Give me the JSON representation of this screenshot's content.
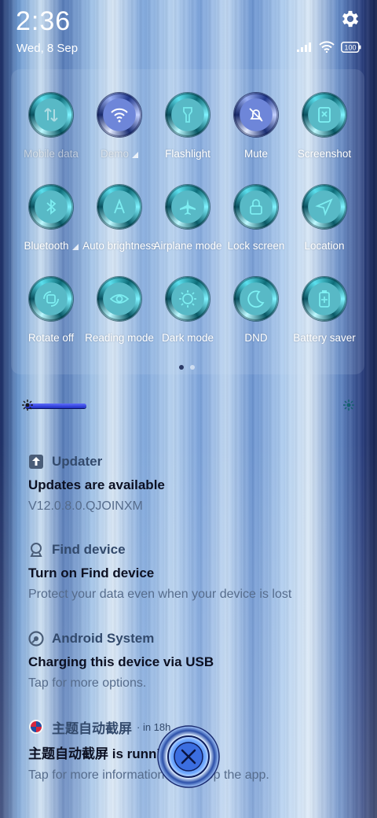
{
  "status_bar": {
    "time": "2:36",
    "date": "Wed, 8 Sep",
    "battery": "100"
  },
  "quick_settings": {
    "tiles": [
      {
        "label": "Mobile data",
        "icon": "mobile-data-icon",
        "active": false,
        "dim": true,
        "caret": false
      },
      {
        "label": "Demo",
        "icon": "wifi-icon",
        "active": true,
        "dim": true,
        "caret": true
      },
      {
        "label": "Flashlight",
        "icon": "flashlight-icon",
        "active": false,
        "dim": false,
        "caret": false
      },
      {
        "label": "Mute",
        "icon": "mute-bell-icon",
        "active": true,
        "dim": false,
        "caret": false
      },
      {
        "label": "Screenshot",
        "icon": "screenshot-icon",
        "active": false,
        "dim": false,
        "caret": false
      },
      {
        "label": "Bluetooth",
        "icon": "bluetooth-icon",
        "active": false,
        "dim": false,
        "caret": true
      },
      {
        "label": "Auto brightness",
        "icon": "auto-brightness-icon",
        "active": false,
        "dim": false,
        "caret": false
      },
      {
        "label": "Airplane mode",
        "icon": "airplane-icon",
        "active": false,
        "dim": false,
        "caret": false
      },
      {
        "label": "Lock screen",
        "icon": "lock-icon",
        "active": false,
        "dim": false,
        "caret": false
      },
      {
        "label": "Location",
        "icon": "location-icon",
        "active": false,
        "dim": false,
        "caret": false
      },
      {
        "label": "Rotate off",
        "icon": "rotate-icon",
        "active": false,
        "dim": false,
        "caret": false
      },
      {
        "label": "Reading mode",
        "icon": "eye-icon",
        "active": false,
        "dim": false,
        "caret": false
      },
      {
        "label": "Dark mode",
        "icon": "dark-mode-icon",
        "active": false,
        "dim": false,
        "caret": false
      },
      {
        "label": "DND",
        "icon": "moon-icon",
        "active": false,
        "dim": false,
        "caret": false
      },
      {
        "label": "Battery saver",
        "icon": "battery-saver-icon",
        "active": false,
        "dim": false,
        "caret": false
      }
    ],
    "page_count": 2,
    "current_page": 1
  },
  "notifications": [
    {
      "app": "Updater",
      "time": "",
      "title": "Updates are available",
      "text": "V12.0.8.0.QJOINXM",
      "icon": "updater-icon"
    },
    {
      "app": "Find device",
      "time": "",
      "title": "Turn on Find device",
      "text": "Protect your data even when your device is lost",
      "icon": "find-device-icon"
    },
    {
      "app": "Android System",
      "time": "",
      "title": "Charging this device via USB",
      "text": "Tap for more options.",
      "icon": "android-system-icon"
    },
    {
      "app": "主题自动截屏",
      "time": "· in 18h",
      "title": "主题自动截屏 is running",
      "text": "Tap for more information or to stop the app.",
      "icon": "app-icon"
    }
  ],
  "colors": {
    "ring_teal": "#58b9c6",
    "ring_blue": "#6e86d9",
    "notif_title": "#0c1022",
    "notif_app": "#334a6c"
  }
}
